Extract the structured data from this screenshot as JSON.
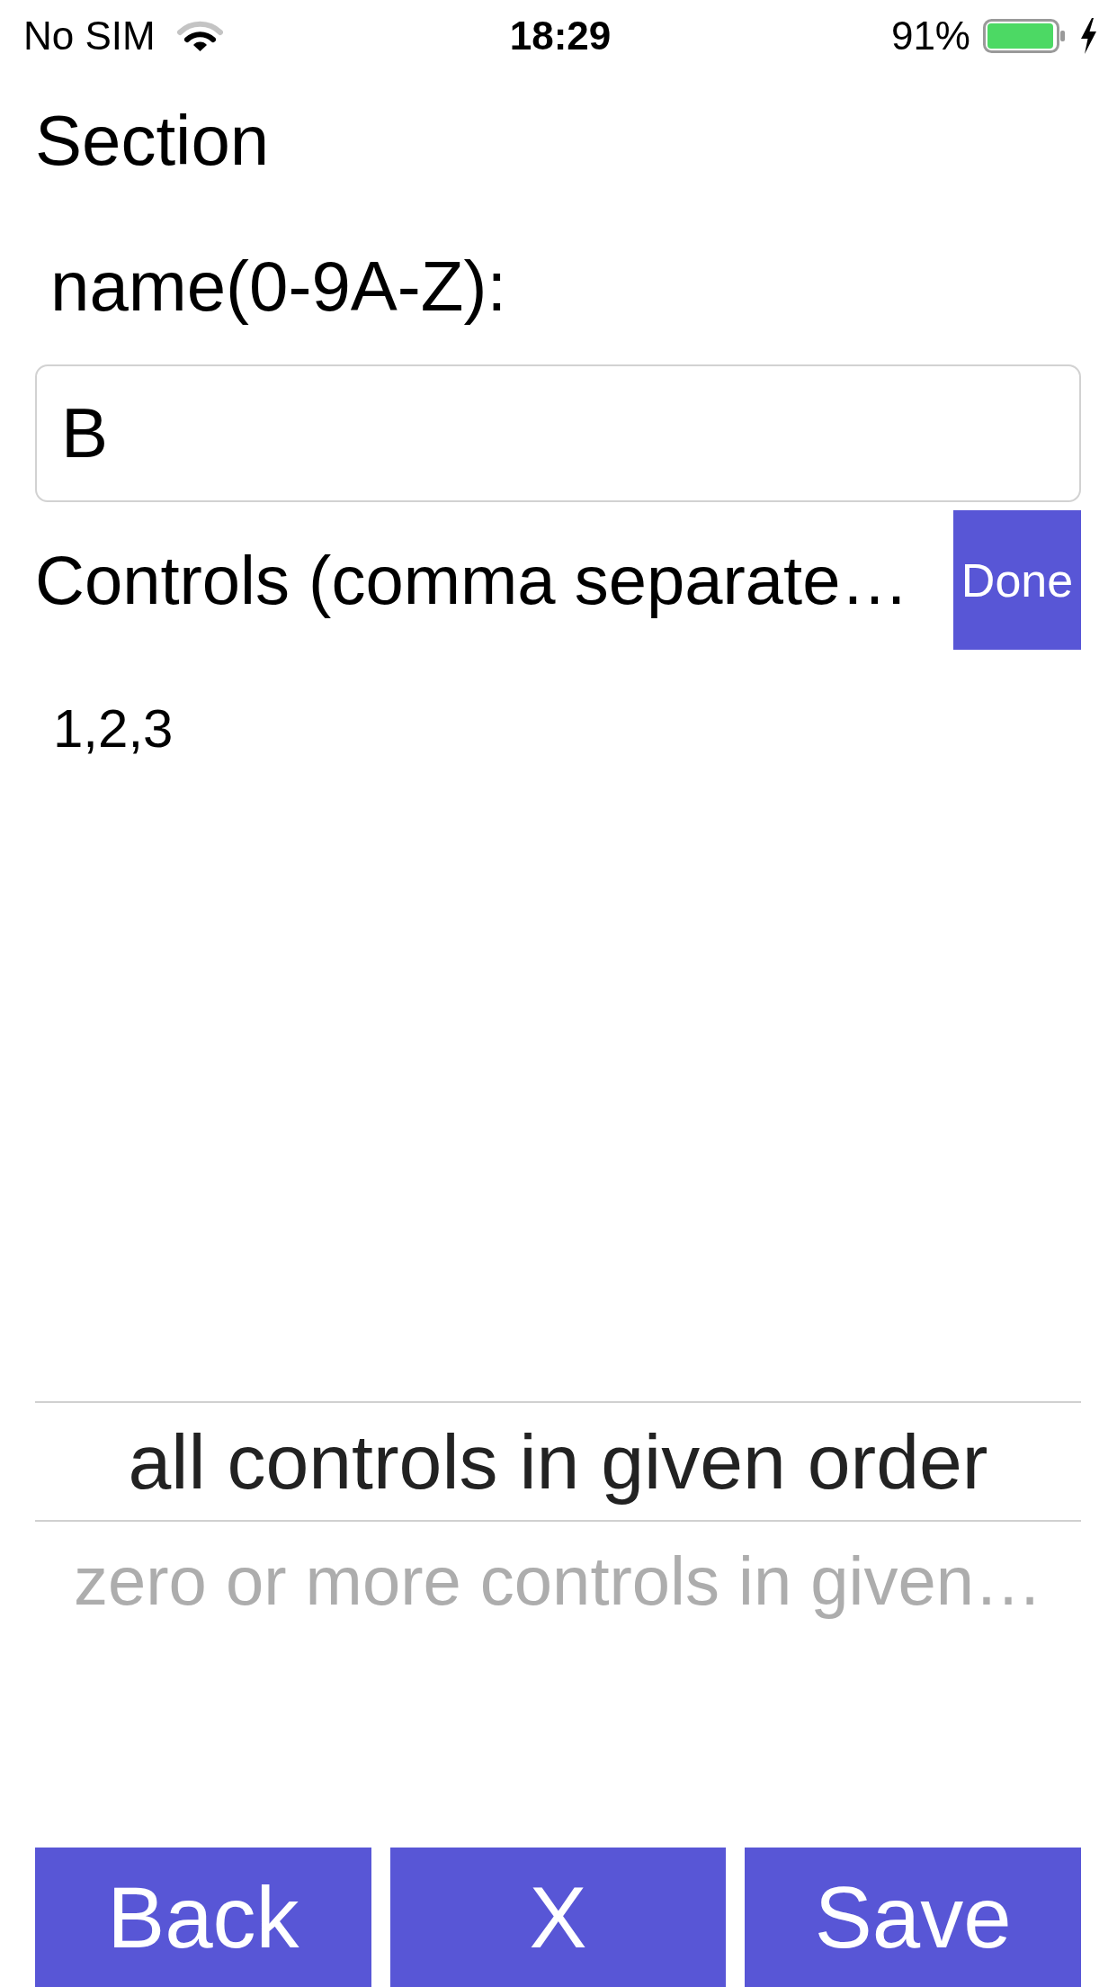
{
  "status_bar": {
    "carrier": "No SIM",
    "time": "18:29",
    "battery": "91%"
  },
  "title": "Section",
  "name_field": {
    "label": "name(0-9A-Z):",
    "value": "B"
  },
  "controls_field": {
    "label": "Controls (comma separate…",
    "value": "1,2,3"
  },
  "done_button": "Done",
  "order_picker": {
    "options": [
      {
        "label": "all controls in given order",
        "selected": true
      },
      {
        "label": "zero or more controls in given…",
        "selected": false
      }
    ]
  },
  "buttons": [
    "Back",
    "X",
    "Save"
  ]
}
